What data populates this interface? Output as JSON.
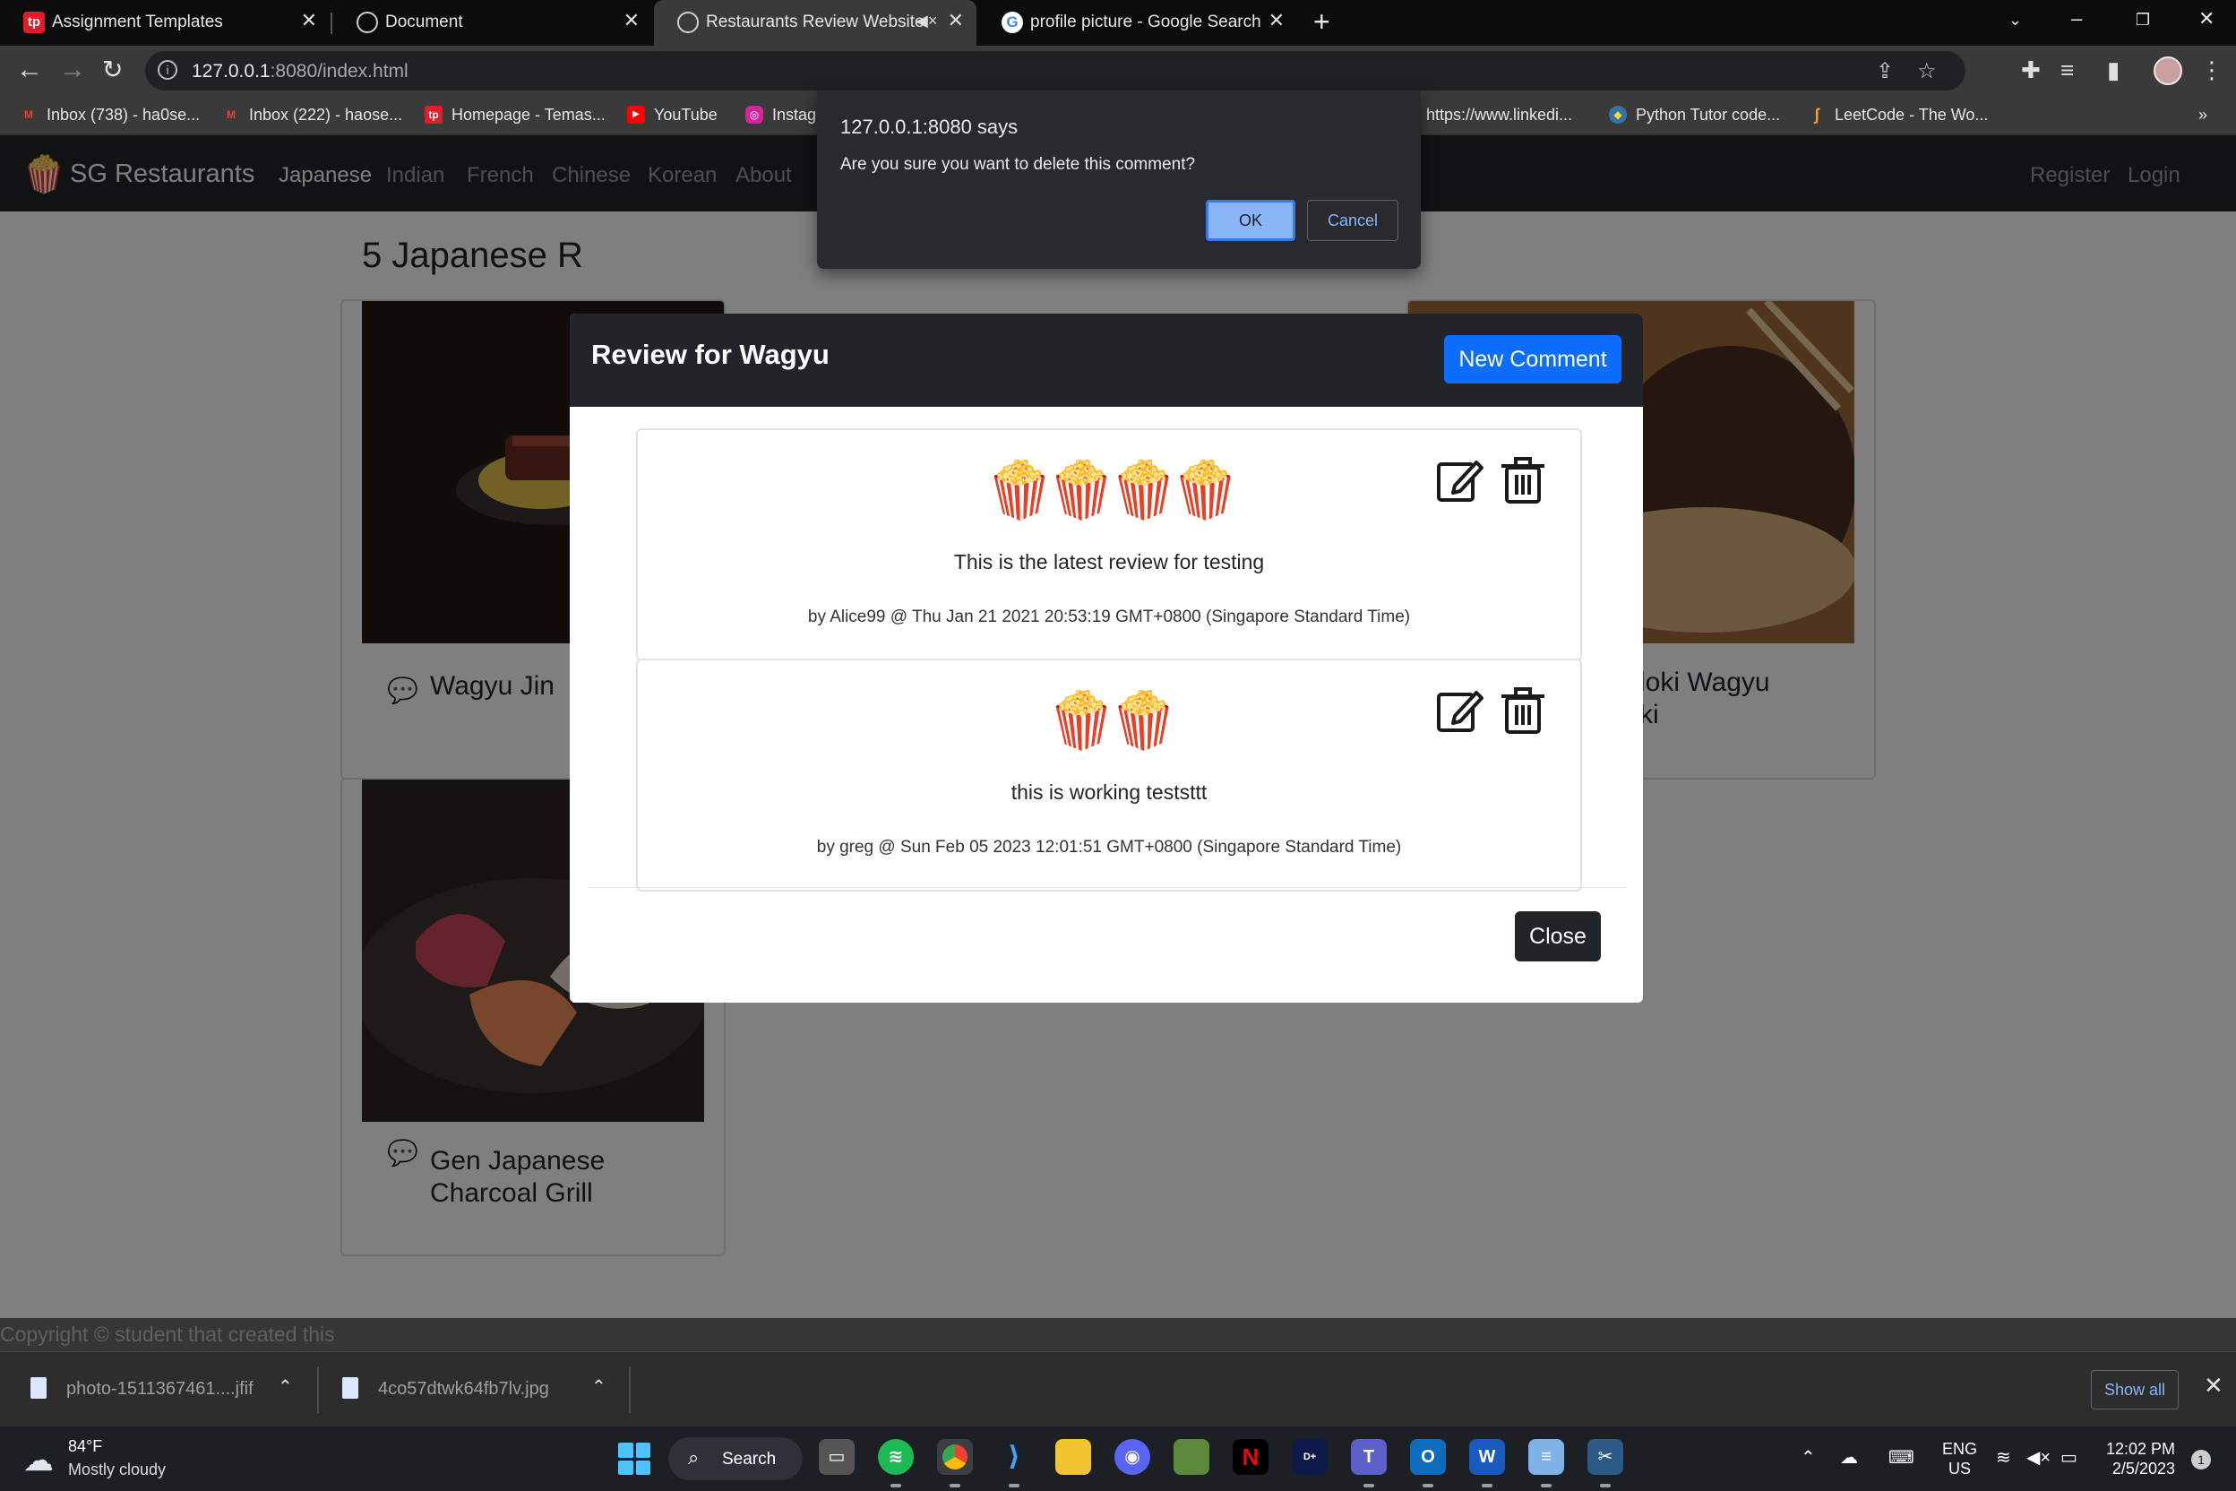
{
  "browser": {
    "tabs": [
      {
        "title": "Assignment Templates",
        "favicon": "tp-icon"
      },
      {
        "title": "Document",
        "favicon": "globe-icon"
      },
      {
        "title": "Restaurants Review Website",
        "favicon": "globe-icon",
        "active": true,
        "audio": "mute-icon"
      },
      {
        "title": "profile picture - Google Search",
        "favicon": "google-icon"
      }
    ],
    "url_host": "127.0.0.1",
    "url_rest": ":8080/index.html",
    "bookmarks": [
      {
        "label": "Inbox (738) - ha0se...",
        "icon": "gmail-icon"
      },
      {
        "label": "Inbox (222) - haose...",
        "icon": "gmail-icon"
      },
      {
        "label": "Homepage - Temas...",
        "icon": "tp-icon"
      },
      {
        "label": "YouTube",
        "icon": "youtube-icon"
      },
      {
        "label": "Instag",
        "icon": "instagram-icon"
      },
      {
        "label": "https://www.linkedi...",
        "icon": "linkedin-icon"
      },
      {
        "label": "Python Tutor code...",
        "icon": "python-icon"
      },
      {
        "label": "LeetCode - The Wo...",
        "icon": "leetcode-icon"
      }
    ],
    "bookmarks_more": "»"
  },
  "site": {
    "brand": "SG Restaurants",
    "nav": [
      "Japanese",
      "Indian",
      "French",
      "Chinese",
      "Korean",
      "About"
    ],
    "nav_right": [
      "Register",
      "Login"
    ],
    "heading": "5 Japanese R",
    "cards": [
      {
        "title": "Wagyu Jin"
      },
      {
        "title": "loki Wagyu",
        "title2": "ki"
      },
      {
        "title": "Gen Japanese",
        "title2": "Charcoal Grill"
      }
    ],
    "footer": "Copyright © student that created this"
  },
  "modal": {
    "title": "Review for Wagyu",
    "new_comment": "New Comment",
    "close": "Close",
    "reviews": [
      {
        "rating": 4,
        "rating_icon": "popcorn-icon",
        "text": "This is the latest review for testing",
        "meta": "by Alice99 @ Thu Jan 21 2021 20:53:19 GMT+0800 (Singapore Standard Time)"
      },
      {
        "rating": 2,
        "rating_icon": "popcorn-icon",
        "text": "this is working teststtt",
        "meta": "by greg @ Sun Feb 05 2023 12:01:51 GMT+0800 (Singapore Standard Time)"
      }
    ]
  },
  "alert": {
    "title": "127.0.0.1:8080 says",
    "message": "Are you sure you want to delete this comment?",
    "ok": "OK",
    "cancel": "Cancel"
  },
  "downloads": {
    "items": [
      "photo-1511367461....jfif",
      "4co57dtwk64fb7lv.jpg"
    ],
    "show_all": "Show all"
  },
  "taskbar": {
    "temp": "84°F",
    "condition": "Mostly cloudy",
    "search": "Search",
    "lang1": "ENG",
    "lang2": "US",
    "time": "12:02 PM",
    "date": "2/5/2023",
    "notifications": "1"
  },
  "colors": {
    "primary": "#0d6efd",
    "dark": "#212529",
    "dialog": "#292a2d",
    "dialog_accent": "#8ab4f8"
  }
}
